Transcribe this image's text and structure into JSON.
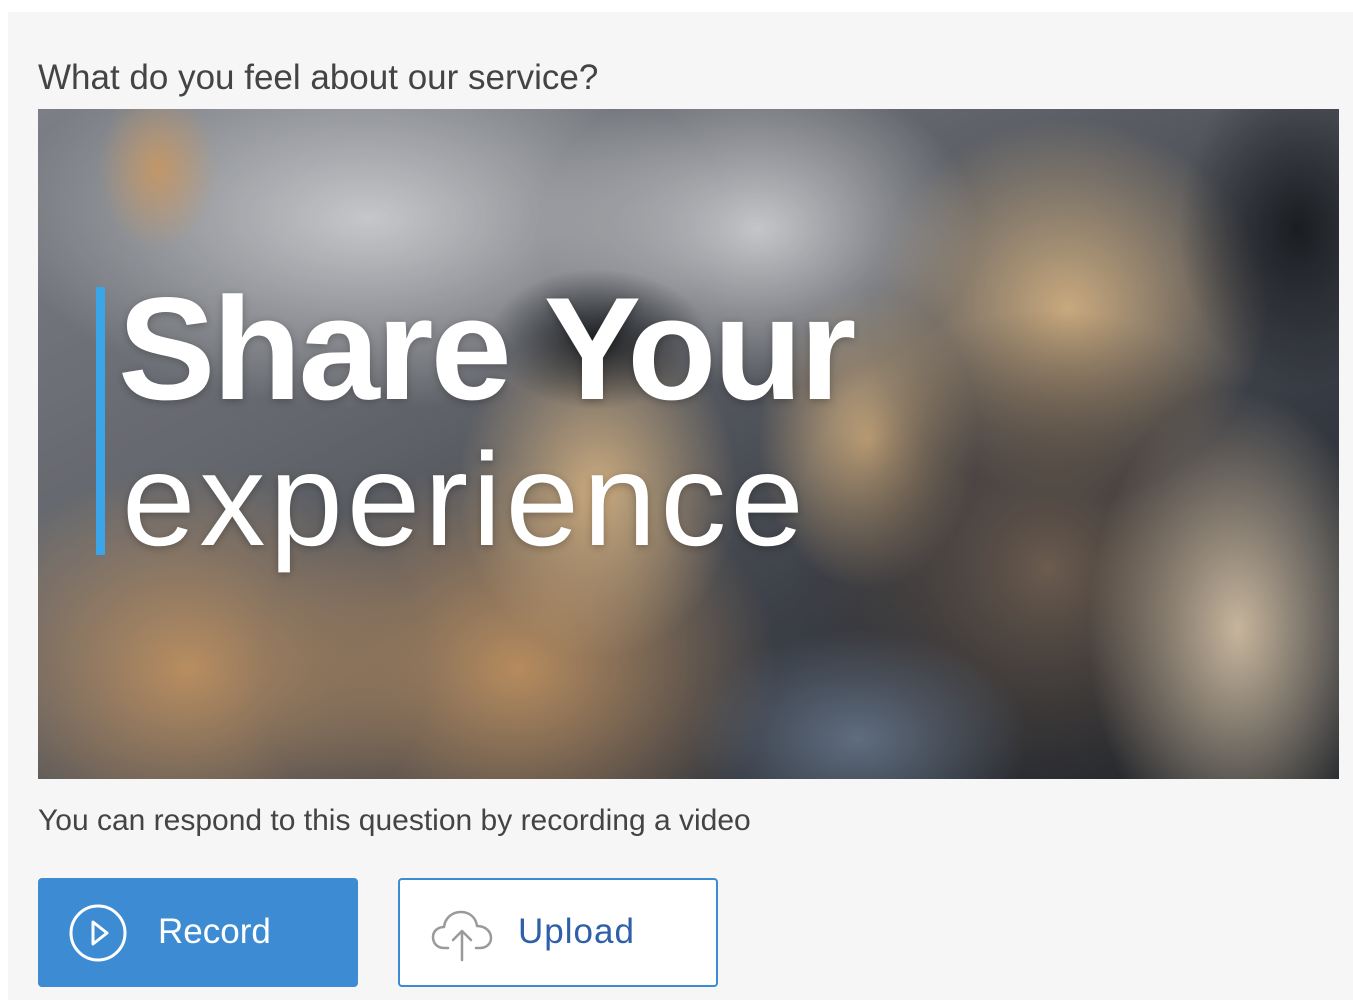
{
  "question": {
    "text": "What do you feel about our service?"
  },
  "hero": {
    "headline_line1": "Share Your",
    "headline_line2": "experience",
    "accent_color": "#3aa5e8"
  },
  "helper_text": "You can respond to this question by recording a video",
  "actions": {
    "record": {
      "label": "Record",
      "icon": "play-circle-icon",
      "color": "#3d8bd3"
    },
    "upload": {
      "label": "Upload",
      "icon": "cloud-upload-icon",
      "border_color": "#3d8bd3",
      "text_color": "#2e5fa8"
    }
  }
}
